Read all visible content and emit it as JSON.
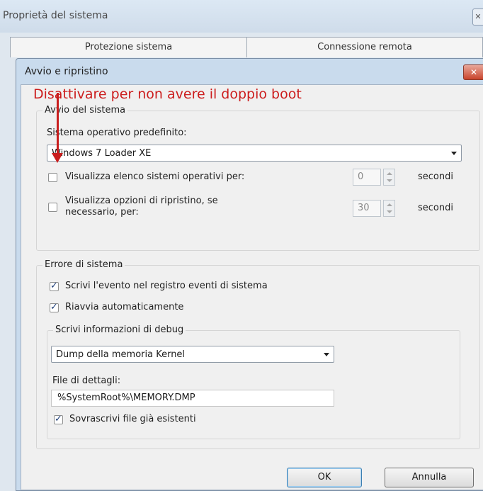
{
  "outer_window": {
    "title": "Proprietà del sistema",
    "close_glyph": "✕",
    "tabs": [
      "Protezione sistema",
      "Connessione remota"
    ]
  },
  "dialog": {
    "title": "Avvio e ripristino",
    "close_glyph": "✕",
    "annotation": "Disattivare per non avere il doppio boot",
    "annotation_color": "#cc1d1d",
    "startup_group": {
      "legend": "Avvio del sistema",
      "default_os_label": "Sistema operativo predefinito:",
      "default_os_value": "Windows 7 Loader XE",
      "show_os_list": {
        "label": "Visualizza elenco sistemi operativi per:",
        "checked": false,
        "value": "0",
        "unit": "secondi"
      },
      "show_recovery": {
        "label_line1": "Visualizza opzioni di ripristino, se",
        "label_line2": "necessario, per:",
        "checked": false,
        "value": "30",
        "unit": "secondi"
      }
    },
    "system_failure_group": {
      "legend": "Errore di sistema",
      "write_event": {
        "label": "Scrivi l'evento nel registro eventi di sistema",
        "checked": true
      },
      "auto_restart": {
        "label": "Riavvia automaticamente",
        "checked": true
      },
      "debug_group": {
        "legend": "Scrivi informazioni di debug",
        "dump_type": "Dump della memoria Kernel",
        "dump_file_label": "File di dettagli:",
        "dump_file_value": "%SystemRoot%\\MEMORY.DMP",
        "overwrite": {
          "label": "Sovrascrivi file già esistenti",
          "checked": true
        }
      }
    },
    "buttons": {
      "ok": "OK",
      "cancel": "Annulla"
    }
  }
}
